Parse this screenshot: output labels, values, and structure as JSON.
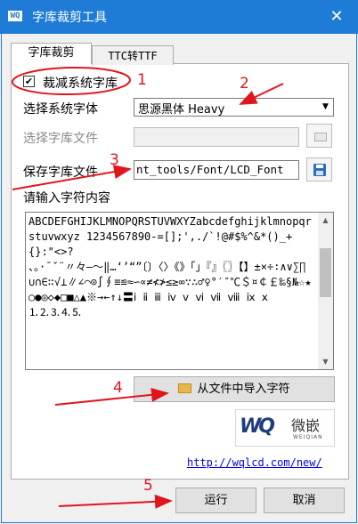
{
  "window": {
    "title": "字库裁剪工具",
    "icon_text": "WQ",
    "close_symbol": "✕"
  },
  "tabs": [
    {
      "label": "字库裁剪",
      "active": true
    },
    {
      "label": "TTC转TTF",
      "active": false
    }
  ],
  "crop_checkbox": {
    "label": "裁减系统字库",
    "checked": true,
    "mark": "✔"
  },
  "system_font": {
    "label": "选择系统字体",
    "value": "思源黑体 Heavy"
  },
  "font_file": {
    "label": "选择字库文件",
    "value": "",
    "enabled": false
  },
  "save_file": {
    "label": "保存字库文件",
    "value": "nt_tools/Font/LCD_Font"
  },
  "input_chars": {
    "label": "请输入字符内容",
    "value": "ABCDEFGHIJKLMNOPQRSTUVWXYZabcdefghijklmnopqrstuvwxyz 1234567890-=[];',./`!@#$%^&*()_+{}:\"<>?\n、。·ˉˇ¨〃々—～‖…‘’“”〔〕〈〉《》「」『』〖〗【】±×÷∶∧∨∑∏∪∩∈∷√⊥∥∠⌒⊙∫∮≡≌≈∽∝≠≮≯≤≥∞∵∴♂♀°′″℃＄¤￠￡‰§№☆★○●◎◇◆□■△▲※→←↑↓〓ⅰ ⅱ ⅲ ⅳ ⅴ ⅵ ⅶ ⅷ ⅸ ⅹ        ⒈⒉⒊⒋⒌"
  },
  "import_button": {
    "label": "从文件中导入字符"
  },
  "logo": {
    "cn": "微嵌",
    "en": "WEIQIAN",
    "mark": "WQ"
  },
  "website": "http://wqlcd.com/new/",
  "buttons": {
    "run": "运行",
    "cancel": "取消"
  },
  "annotations": [
    "1",
    "2",
    "3",
    "4",
    "5"
  ],
  "colors": {
    "titlebar": "#1e7bd6",
    "annotation": "#e0161e",
    "link": "#0000ee",
    "save_icon": "#2a6fc0"
  }
}
